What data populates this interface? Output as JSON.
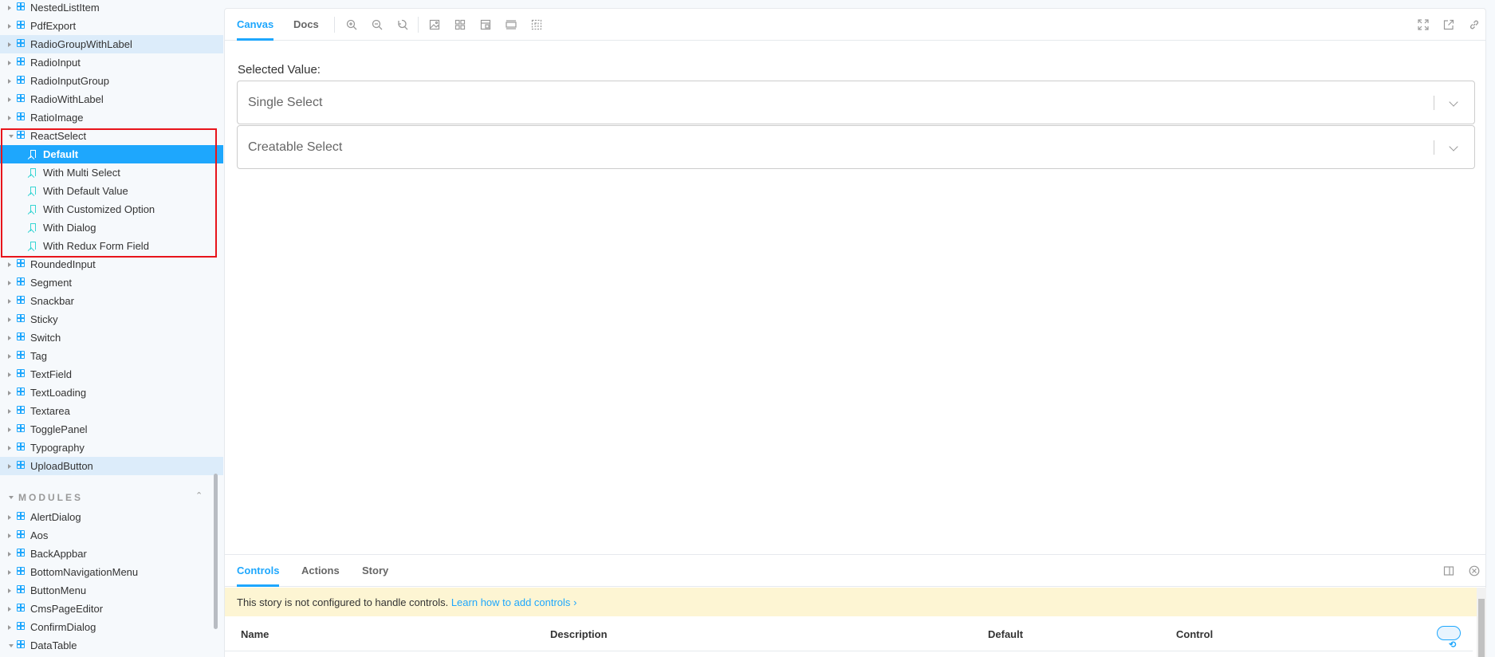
{
  "sidebar": {
    "components_top": [
      {
        "label": "NestedListItem"
      },
      {
        "label": "PdfExport"
      },
      {
        "label": "RadioGroupWithLabel"
      },
      {
        "label": "RadioInput"
      },
      {
        "label": "RadioInputGroup"
      },
      {
        "label": "RadioWithLabel"
      },
      {
        "label": "RatioImage"
      },
      {
        "label": "ReactSelect"
      }
    ],
    "stories": [
      {
        "label": "Default"
      },
      {
        "label": "With Multi Select"
      },
      {
        "label": "With Default Value"
      },
      {
        "label": "With Customized Option"
      },
      {
        "label": "With Dialog"
      },
      {
        "label": "With Redux Form Field"
      }
    ],
    "components_bottom": [
      {
        "label": "RoundedInput"
      },
      {
        "label": "Segment"
      },
      {
        "label": "Snackbar"
      },
      {
        "label": "Sticky"
      },
      {
        "label": "Switch"
      },
      {
        "label": "Tag"
      },
      {
        "label": "TextField"
      },
      {
        "label": "TextLoading"
      },
      {
        "label": "Textarea"
      },
      {
        "label": "TogglePanel"
      },
      {
        "label": "Typography"
      },
      {
        "label": "UploadButton"
      }
    ],
    "modules_title": "MODULES",
    "modules": [
      {
        "label": "AlertDialog"
      },
      {
        "label": "Aos"
      },
      {
        "label": "BackAppbar"
      },
      {
        "label": "BottomNavigationMenu"
      },
      {
        "label": "ButtonMenu"
      },
      {
        "label": "CmsPageEditor"
      },
      {
        "label": "ConfirmDialog"
      },
      {
        "label": "DataTable"
      }
    ]
  },
  "toolbar": {
    "tabs": [
      {
        "label": "Canvas"
      },
      {
        "label": "Docs"
      }
    ],
    "active_tab": "Canvas"
  },
  "canvas": {
    "selected_value_label": "Selected Value:",
    "selects": [
      {
        "placeholder": "Single Select"
      },
      {
        "placeholder": "Creatable Select"
      }
    ]
  },
  "addons": {
    "tabs": [
      {
        "label": "Controls"
      },
      {
        "label": "Actions"
      },
      {
        "label": "Story"
      }
    ],
    "notice_text": "This story is not configured to handle controls.",
    "notice_link": "Learn how to add controls",
    "columns": [
      "Name",
      "Description",
      "Default",
      "Control"
    ]
  },
  "colors": {
    "accent": "#1ea7fd",
    "highlight_box": "#e8141b",
    "notice_bg": "#fdf5d3"
  }
}
